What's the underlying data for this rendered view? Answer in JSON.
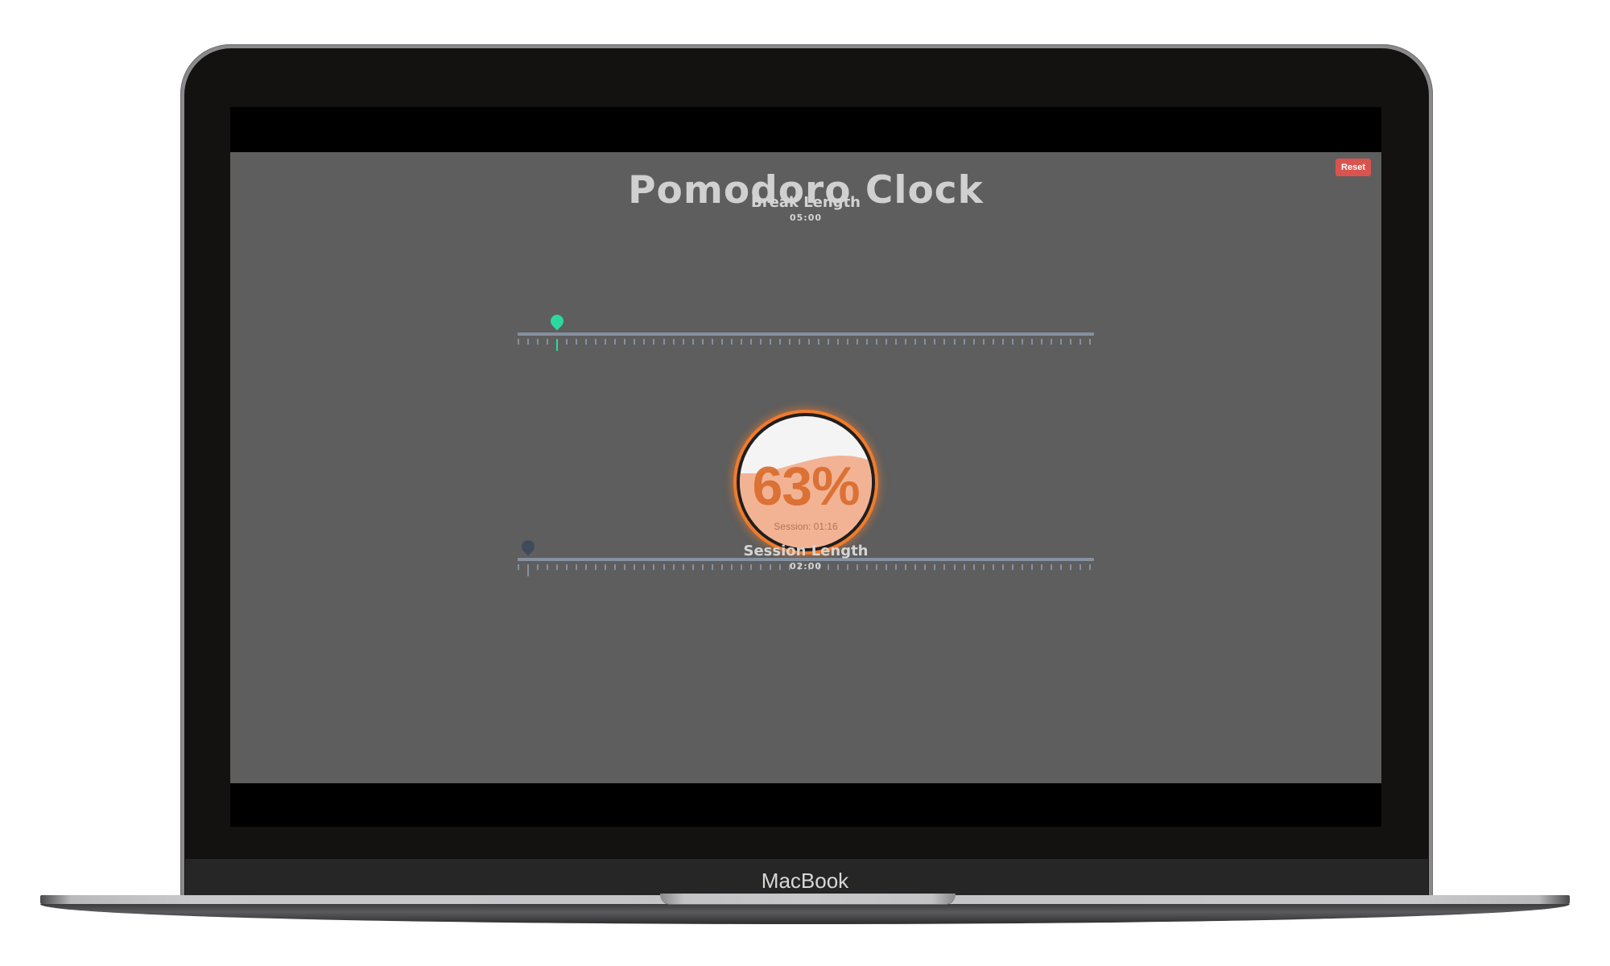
{
  "device": {
    "brand_label": "MacBook"
  },
  "app": {
    "title": "Pomodoro Clock",
    "reset_label": "Reset",
    "colors": {
      "background": "#5e5e5e",
      "reset": "#d9534f",
      "break_thumb": "#2bd9a0",
      "session_thumb": "#3f4a5a",
      "gauge_ring": "#f07b2c",
      "gauge_fill": "#f2b395"
    },
    "break": {
      "label": "Break Length",
      "value_text": "05:00",
      "minutes": 5,
      "min": 1,
      "max": 60
    },
    "session": {
      "label": "Session Length",
      "value_text": "02:00",
      "minutes": 2,
      "min": 1,
      "max": 60
    },
    "progress": {
      "percent_text": "63%",
      "percent": 63,
      "session_text": "Session: 01:16"
    }
  }
}
